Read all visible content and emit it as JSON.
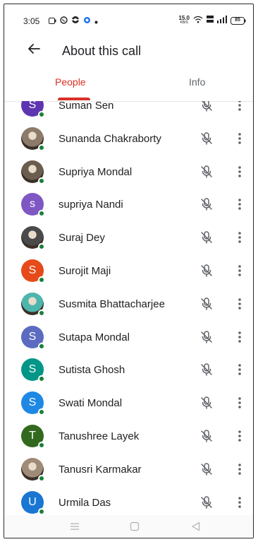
{
  "status_bar": {
    "time": "3:05",
    "net_speed_value": "15.0",
    "net_speed_unit": "KB/S",
    "battery": "85"
  },
  "header": {
    "title": "About this call",
    "back_icon": "arrow-left-icon"
  },
  "tabs": [
    {
      "label": "People",
      "selected": true
    },
    {
      "label": "Info",
      "selected": false
    }
  ],
  "colors": {
    "accent": "#d93025",
    "online": "#188038"
  },
  "participants": [
    {
      "name": "Suman Sen",
      "initial": "S",
      "color": "#5e35b1",
      "photo": false
    },
    {
      "name": "Sunanda Chakraborty",
      "initial": "",
      "color": "#8d7b6a",
      "photo": true
    },
    {
      "name": "Supriya Mondal",
      "initial": "",
      "color": "#6b5d4f",
      "photo": true
    },
    {
      "name": "supriya Nandi",
      "initial": "s",
      "color": "#7e57c2",
      "photo": false
    },
    {
      "name": "Suraj Dey",
      "initial": "",
      "color": "#4a4a4a",
      "photo": true
    },
    {
      "name": "Surojit Maji",
      "initial": "S",
      "color": "#e64a19",
      "photo": false
    },
    {
      "name": "Susmita Bhattacharjee",
      "initial": "",
      "color": "#4db6ac",
      "photo": true
    },
    {
      "name": "Sutapa Mondal",
      "initial": "S",
      "color": "#5c6bc0",
      "photo": false
    },
    {
      "name": "Sutista Ghosh",
      "initial": "S",
      "color": "#009688",
      "photo": false
    },
    {
      "name": "Swati Mondal",
      "initial": "S",
      "color": "#1e88e5",
      "photo": false
    },
    {
      "name": "Tanushree Layek",
      "initial": "T",
      "color": "#33691e",
      "photo": false
    },
    {
      "name": "Tanusri Karmakar",
      "initial": "",
      "color": "#a08a78",
      "photo": true
    },
    {
      "name": "Urmila Das",
      "initial": "U",
      "color": "#1976d2",
      "photo": false
    }
  ],
  "row_icons": {
    "mic": "mic-off-icon",
    "more": "more-vert-icon"
  },
  "nav_bar": {
    "menu_icon": "menu-icon",
    "home_icon": "home-square-icon",
    "back_icon": "back-triangle-icon"
  }
}
